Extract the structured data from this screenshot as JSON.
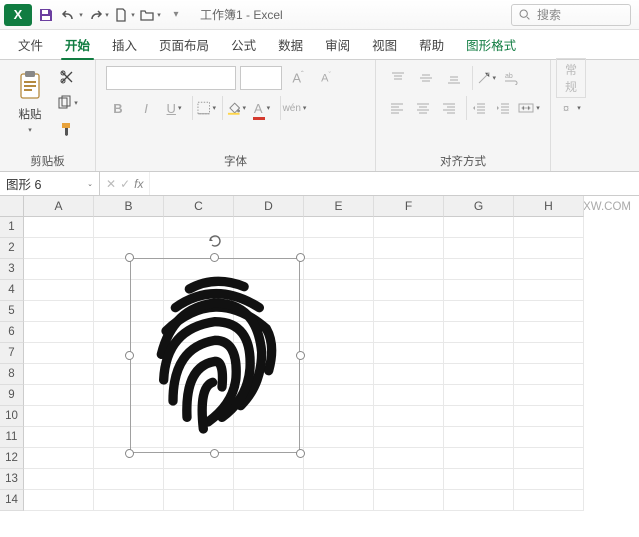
{
  "title_bar": {
    "doc_title": "工作簿1 - Excel",
    "app_letter": "X"
  },
  "search": {
    "placeholder": "搜索"
  },
  "tabs": {
    "file": "文件",
    "home": "开始",
    "insert": "插入",
    "layout": "页面布局",
    "formulas": "公式",
    "data": "数据",
    "review": "审阅",
    "view": "视图",
    "help": "帮助",
    "shape_format": "图形格式"
  },
  "ribbon": {
    "clipboard": {
      "label": "剪贴板",
      "paste": "粘贴"
    },
    "font": {
      "label": "字体",
      "name": "",
      "size": "",
      "wen": "wén"
    },
    "alignment": {
      "label": "对齐方式"
    },
    "general": {
      "label": "常规"
    }
  },
  "name_box": {
    "value": "图形 6"
  },
  "formula_bar": {
    "fx": "fx"
  },
  "watermark": "软件自学网：RJZXW.COM",
  "columns": [
    "A",
    "B",
    "C",
    "D",
    "E",
    "F",
    "G",
    "H"
  ],
  "rows": [
    "1",
    "2",
    "3",
    "4",
    "5",
    "6",
    "7",
    "8",
    "9",
    "10",
    "11",
    "12",
    "13",
    "14"
  ],
  "shape": {
    "name": "fingerprint-icon"
  }
}
